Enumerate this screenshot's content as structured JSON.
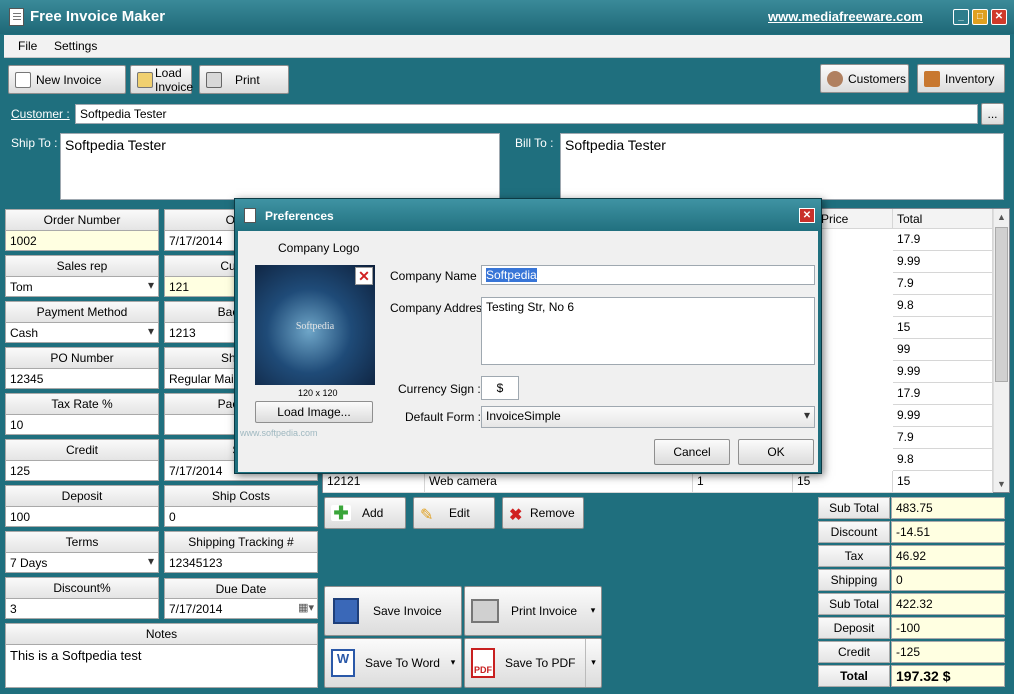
{
  "window": {
    "title": "Free Invoice Maker",
    "site": "www.mediafreeware.com",
    "min": "_",
    "max": "□",
    "close": "✕"
  },
  "menu": [
    "File",
    "Settings"
  ],
  "toolbar": {
    "new_invoice": "New Invoice",
    "load_invoice": "Load Invoice",
    "print": "Print",
    "customers": "Customers",
    "inventory": "Inventory"
  },
  "customer": {
    "label": "Customer :",
    "value": "Softpedia Tester",
    "browse": "..."
  },
  "ship_to": {
    "label": "Ship To :",
    "value": "Softpedia Tester"
  },
  "bill_to": {
    "label": "Bill To :",
    "value": "Softpedia Tester"
  },
  "left_fields": [
    {
      "label": "Order Number",
      "value": "1002"
    },
    {
      "label": "Sales rep",
      "value": "Tom"
    },
    {
      "label": "Payment Method",
      "value": "Cash"
    },
    {
      "label": "PO Number",
      "value": "12345"
    },
    {
      "label": "Tax Rate %",
      "value": "10"
    },
    {
      "label": "Credit",
      "value": "125"
    },
    {
      "label": "Deposit",
      "value": "100"
    },
    {
      "label": "Terms",
      "value": "7 Days"
    },
    {
      "label": "Discount%",
      "value": "3"
    }
  ],
  "mid_fields": [
    {
      "label": "Order",
      "value": "7/17/2014"
    },
    {
      "label": "Custom",
      "value": "121"
    },
    {
      "label": "BackOrd",
      "value": "1213"
    },
    {
      "label": "Shippin",
      "value": "Regular Mail"
    },
    {
      "label": "Package",
      "value": ""
    },
    {
      "label": "Shi",
      "value": "7/17/2014"
    },
    {
      "label": "Ship Costs",
      "value": "0"
    },
    {
      "label": "Shipping Tracking #",
      "value": "12345123"
    },
    {
      "label": "Due Date",
      "value": "7/17/2014"
    }
  ],
  "notes": {
    "label": "Notes",
    "value": "This is a Softpedia test"
  },
  "grid": {
    "headers": {
      "price": "Price",
      "total": "Total"
    },
    "totals": [
      "17.9",
      "9.99",
      "7.9",
      "9.8",
      "15",
      "99",
      "9.99",
      "17.9",
      "9.99",
      "7.9",
      "9.8",
      "15"
    ],
    "last_row": {
      "code": "12121",
      "desc": "Web camera",
      "qty": "1",
      "price": "15"
    }
  },
  "row_buttons": {
    "add": "Add",
    "edit": "Edit",
    "remove": "Remove"
  },
  "actions": {
    "save_invoice": "Save Invoice",
    "print_invoice": "Print Invoice",
    "save_word": "Save To Word",
    "save_pdf": "Save To PDF"
  },
  "totals": [
    {
      "label": "Sub Total",
      "value": "483.75"
    },
    {
      "label": "Discount",
      "value": "-14.51"
    },
    {
      "label": "Tax",
      "value": "46.92"
    },
    {
      "label": "Shipping",
      "value": "0"
    },
    {
      "label": "Sub Total",
      "value": "422.32"
    },
    {
      "label": "Deposit",
      "value": "-100"
    },
    {
      "label": "Credit",
      "value": "-125"
    },
    {
      "label": "Total",
      "value": "197.32 $"
    }
  ],
  "dialog": {
    "title": "Preferences",
    "logo_label": "Company Logo",
    "logo_text": "Softpedia",
    "logo_size": "120 x 120",
    "load_image": "Load Image...",
    "company_name_label": "Company Name",
    "company_name": "Softpedia",
    "company_address_label": "Company Address",
    "company_address": "Testing Str, No 6",
    "currency_label": "Currency Sign :",
    "currency": "$",
    "form_label": "Default Form :",
    "form": "InvoiceSimple",
    "cancel": "Cancel",
    "ok": "OK"
  },
  "watermark": "www.softpedia.com"
}
